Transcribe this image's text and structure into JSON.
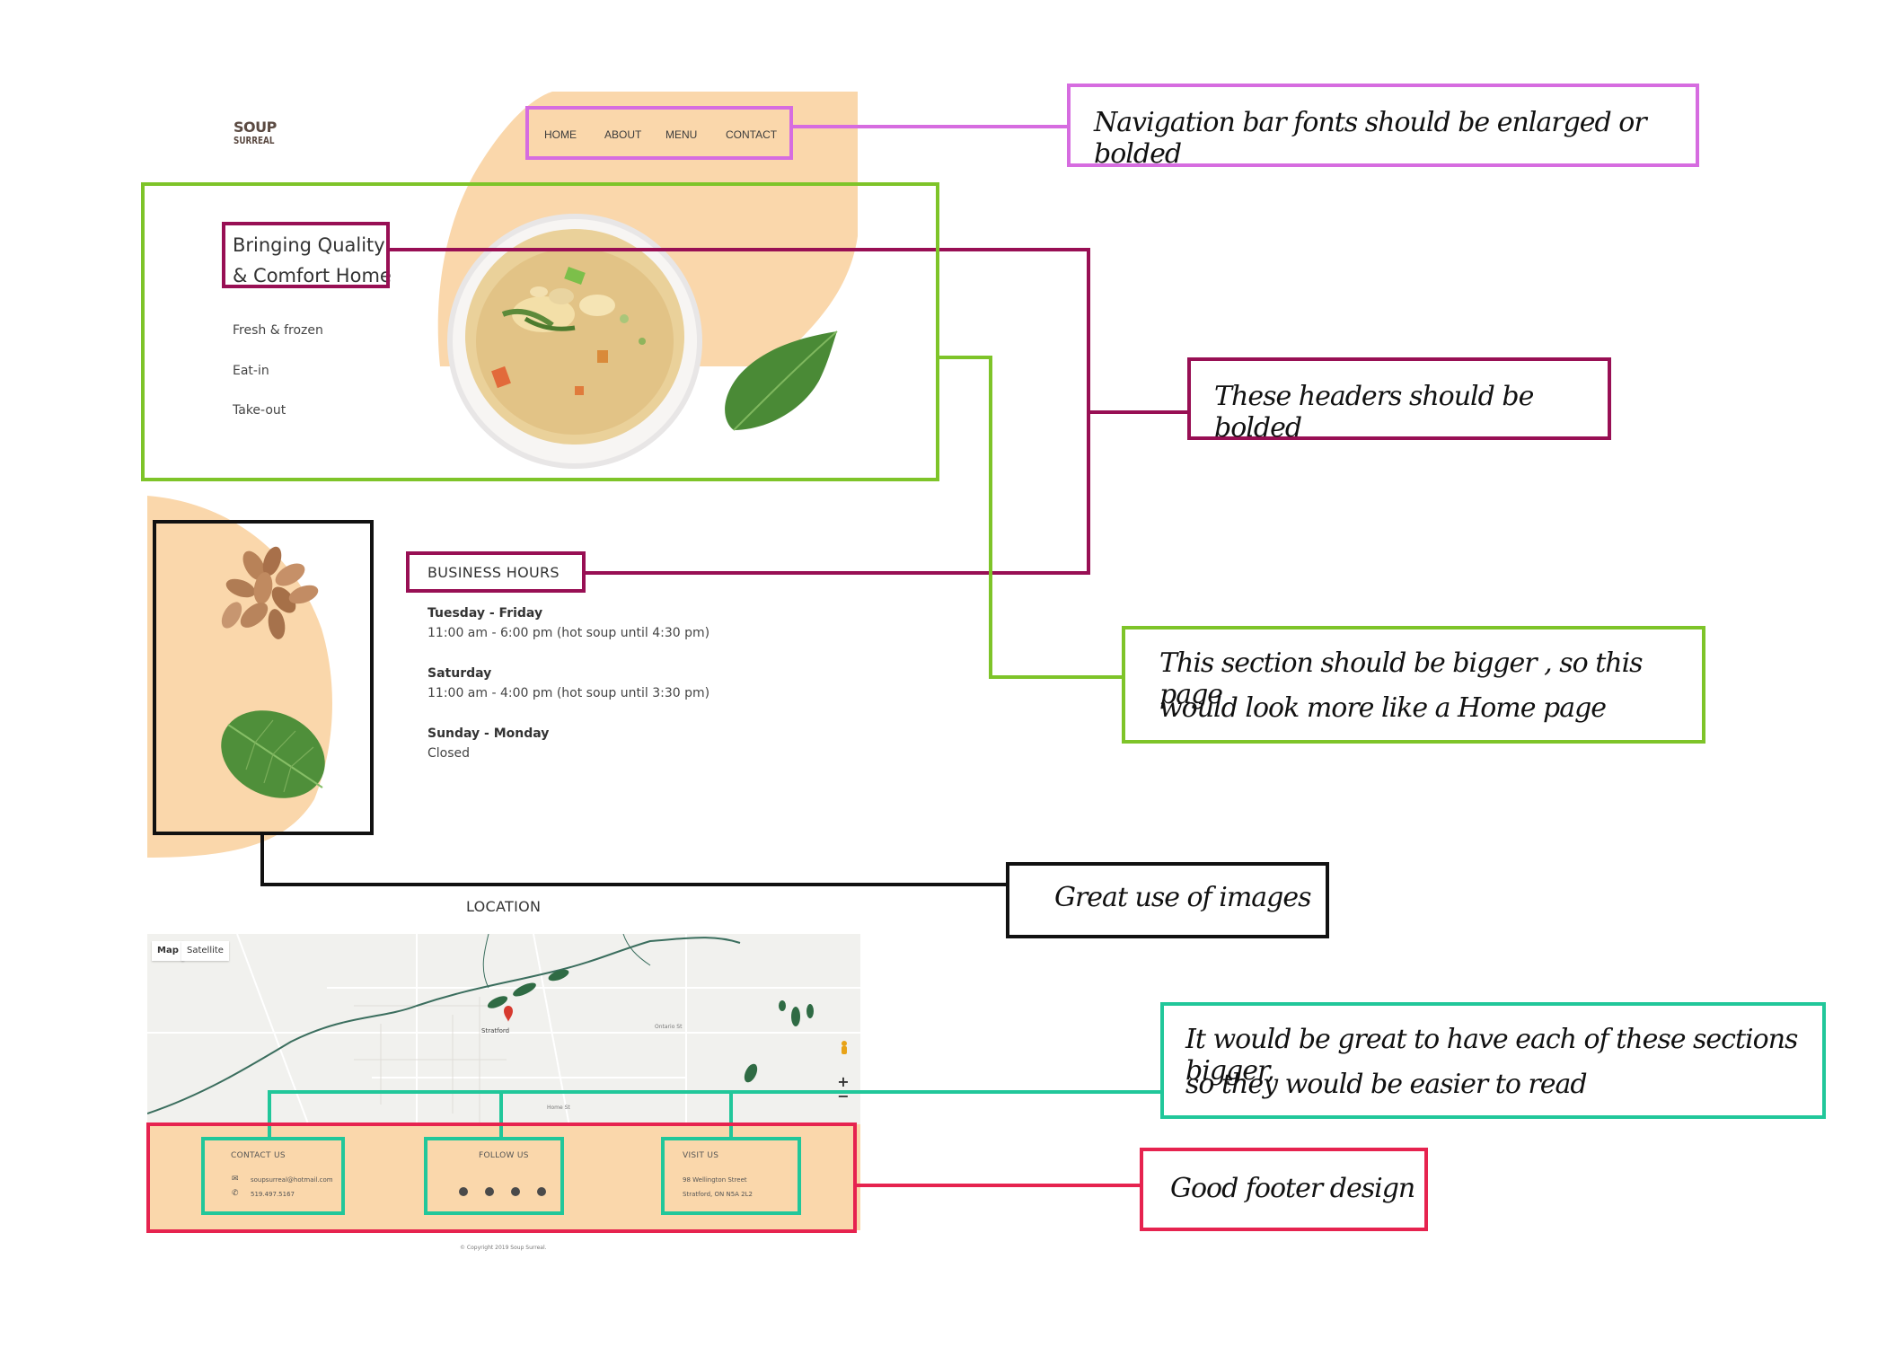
{
  "logo": {
    "line1": "SOUP",
    "line2": "SURREAL"
  },
  "nav": {
    "items": [
      "HOME",
      "ABOUT",
      "MENU",
      "CONTACT"
    ]
  },
  "hero": {
    "title_line1": "Bringing Quality",
    "title_line2": "& Comfort Home",
    "links": [
      "Fresh & frozen",
      "Eat-in",
      "Take-out"
    ]
  },
  "hours": {
    "heading": "BUSINESS HOURS",
    "entries": [
      {
        "day": "Tuesday - Friday",
        "time": "11:00 am - 6:00 pm (hot soup until 4:30 pm)"
      },
      {
        "day": "Saturday",
        "time": "11:00 am - 4:00 pm (hot soup until 3:30 pm)"
      },
      {
        "day": "Sunday - Monday",
        "time": "Closed"
      }
    ]
  },
  "location": {
    "heading": "LOCATION",
    "map_tabs": [
      "Map",
      "Satellite"
    ],
    "map_labels": {
      "city": "Stratford",
      "street": "Ontario St",
      "road": "Home St"
    },
    "zoom_in": "+",
    "zoom_out": "−"
  },
  "footer": {
    "contact_heading": "CONTACT US",
    "email": "soupsurreal@hotmail.com",
    "phone": "519.497.5167",
    "follow_heading": "FOLLOW US",
    "social_icons": [
      "facebook-icon",
      "twitter-icon",
      "instagram-icon",
      "email-icon"
    ],
    "visit_heading": "VISIT US",
    "address_line1": "98 Wellington Street",
    "address_line2": "Stratford, ON N5A 2L2",
    "copyright": "© Copyright 2019 Soup Surreal."
  },
  "annotations": {
    "nav": "Navigation bar fonts should be enlarged or bolded",
    "headers": "These headers should be bolded",
    "hero_line1": "This section should be bigger , so this page",
    "hero_line2": "would look more like a Home page",
    "images": "Great use of images",
    "footer_sections_line1": "It would be great to have each of these sections bigger,",
    "footer_sections_line2": "so they would be easier to read",
    "footer": "Good footer design"
  },
  "colors": {
    "peach": "#fad7ab",
    "nav_annotation": "#d66ce0",
    "header_annotation": "#980f54",
    "hero_annotation": "#7ec429",
    "images_annotation": "#111111",
    "footer_section_annotation": "#21c79a",
    "footer_annotation": "#e6234f"
  }
}
